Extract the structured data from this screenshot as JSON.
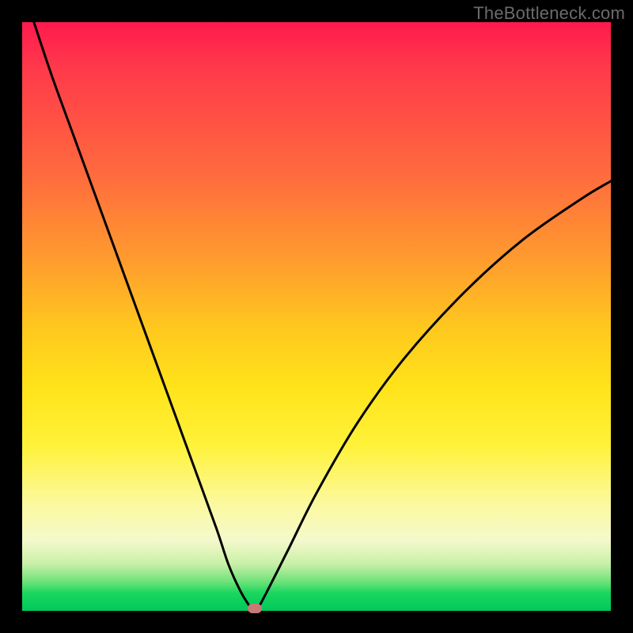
{
  "watermark": "TheBottleneck.com",
  "colors": {
    "frame": "#000000",
    "curve": "#000000",
    "marker": "#c77a74"
  },
  "chart_data": {
    "type": "line",
    "title": "",
    "xlabel": "",
    "ylabel": "",
    "xlim": [
      0,
      100
    ],
    "ylim": [
      0,
      100
    ],
    "grid": false,
    "legend": false,
    "series": [
      {
        "name": "bottleneck-curve",
        "x": [
          2,
          5,
          9,
          13,
          17,
          21,
          25,
          29,
          33,
          35,
          37,
          38.5,
          39.5,
          40.5,
          45,
          50,
          57,
          65,
          75,
          85,
          95,
          100
        ],
        "y": [
          100,
          91,
          80,
          69,
          58,
          47,
          36,
          25,
          14,
          8,
          3.5,
          1,
          0,
          1.2,
          10,
          20,
          32,
          43,
          54,
          63,
          70,
          73
        ]
      }
    ],
    "marker": {
      "x": 39.5,
      "y": 0
    },
    "gradient_stops": [
      {
        "pos": 0,
        "color": "#ff1a4d"
      },
      {
        "pos": 26,
        "color": "#ff6b3e"
      },
      {
        "pos": 52,
        "color": "#ffc81e"
      },
      {
        "pos": 72,
        "color": "#fff23a"
      },
      {
        "pos": 88,
        "color": "#f4f9cc"
      },
      {
        "pos": 100,
        "color": "#00c95b"
      }
    ]
  }
}
